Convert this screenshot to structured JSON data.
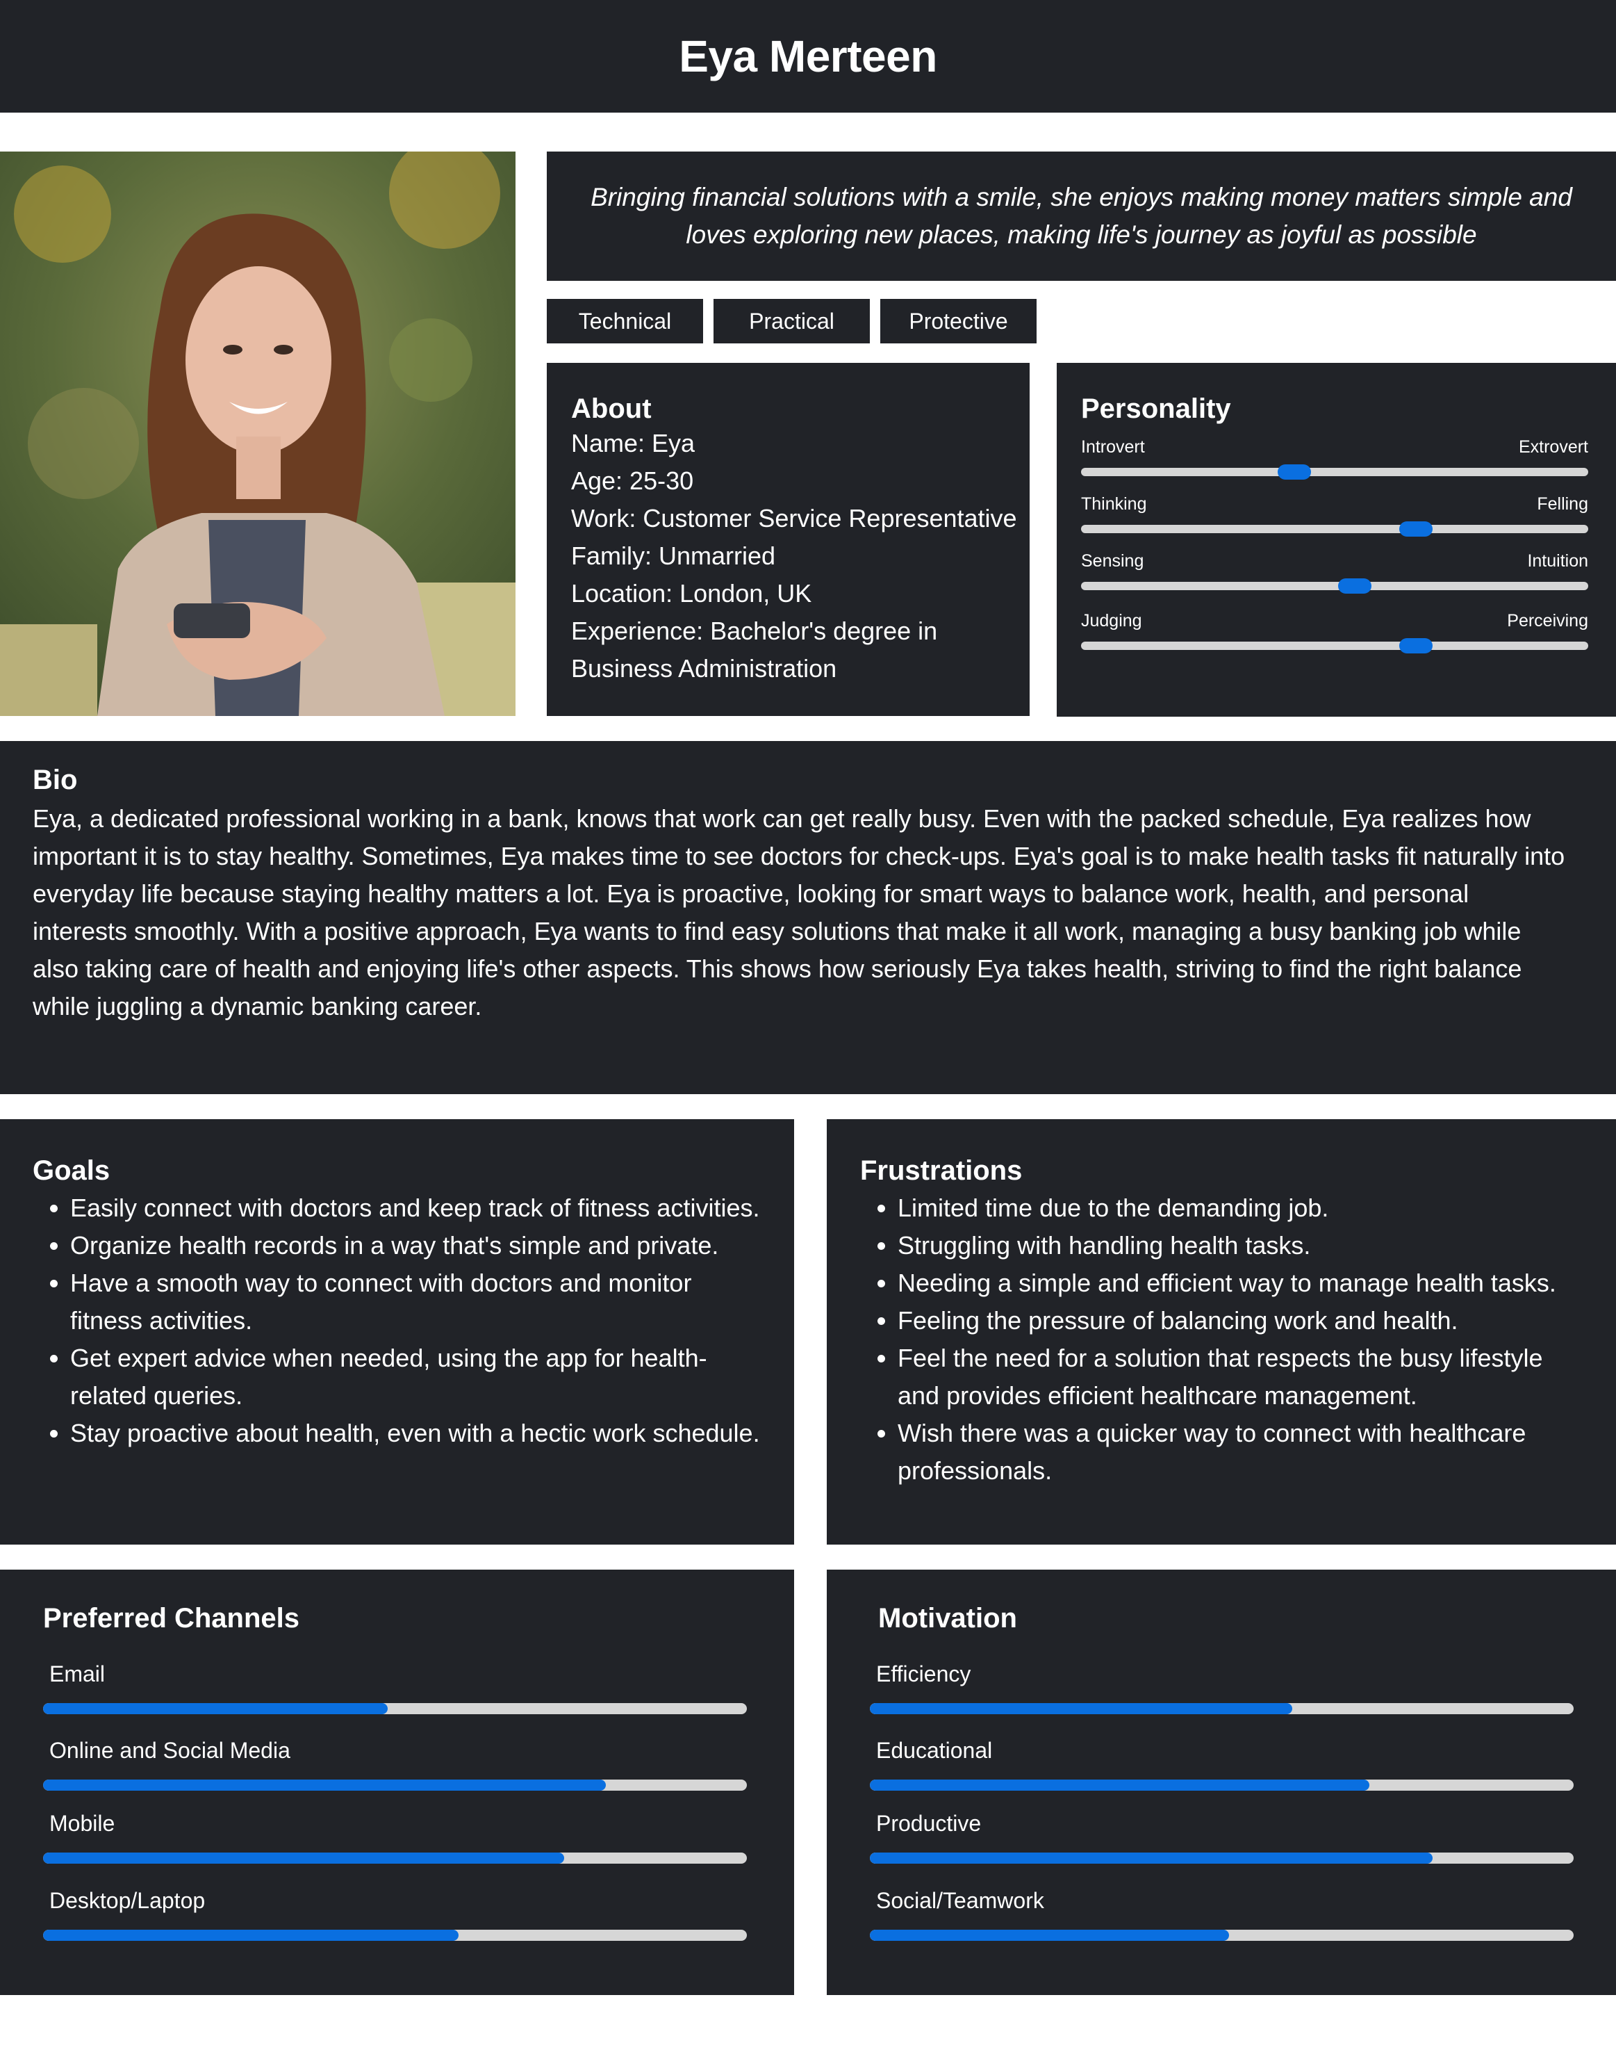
{
  "persona": {
    "name": "Eya Merteen",
    "quote": "Bringing financial solutions with a smile, she enjoys making money matters simple and loves exploring new places, making life's journey as joyful as possible",
    "tags": [
      "Technical",
      "Practical",
      "Protective"
    ]
  },
  "about": {
    "title": "About",
    "rows": [
      "Name: Eya",
      "Age: 25-30",
      "Work: Customer Service Representative",
      "Family: Unmarried",
      "Location: London, UK",
      "Experience: Bachelor's degree in",
      "Business Administration"
    ]
  },
  "personality": {
    "title": "Personality",
    "traits": [
      {
        "left": "Introvert",
        "right": "Extrovert",
        "value": 0.42
      },
      {
        "left": "Thinking",
        "right": "Felling",
        "value": 0.66
      },
      {
        "left": "Sensing",
        "right": "Intuition",
        "value": 0.54
      },
      {
        "left": "Judging",
        "right": "Perceiving",
        "value": 0.66
      }
    ]
  },
  "bio": {
    "title": "Bio",
    "text": "Eya, a dedicated professional working in a bank, knows that work can get really busy. Even with the packed schedule, Eya realizes how important it is to stay healthy. Sometimes, Eya makes time to see doctors for check-ups. Eya's goal is to make health tasks fit naturally into everyday life because staying healthy matters a lot. Eya is proactive, looking for smart ways to balance work, health, and personal interests smoothly. With a positive approach, Eya wants to find easy solutions that make it all work, managing a busy banking job while also taking care of health and enjoying life's other aspects. This shows how seriously Eya takes health, striving to find the right balance while juggling a dynamic banking career."
  },
  "goals": {
    "title": "Goals",
    "items": [
      "Easily connect with doctors and keep track of fitness activities.",
      "Organize health records in a way that's simple and private.",
      "Have a smooth way to connect with doctors and monitor fitness activities.",
      "Get expert advice when needed, using the app for health-related queries.",
      "Stay proactive about health, even with a hectic work schedule."
    ]
  },
  "frustrations": {
    "title": "Frustrations",
    "items": [
      "Limited time due to the demanding job.",
      "Struggling with handling health tasks.",
      "Needing a simple and efficient way to manage health tasks.",
      "Feeling the pressure of balancing work and health.",
      "Feel the need for a solution that respects the busy lifestyle and provides efficient healthcare management.",
      "Wish there was a quicker way to connect with healthcare professionals."
    ]
  },
  "channels": {
    "title": "Preferred Channels",
    "items": [
      {
        "label": "Email",
        "value": 0.49
      },
      {
        "label": "Online and Social Media",
        "value": 0.8
      },
      {
        "label": "Mobile",
        "value": 0.74
      },
      {
        "label": "Desktop/Laptop",
        "value": 0.59
      }
    ]
  },
  "motivation": {
    "title": "Motivation",
    "items": [
      {
        "label": "Efficiency",
        "value": 0.6
      },
      {
        "label": "Educational",
        "value": 0.71
      },
      {
        "label": "Productive",
        "value": 0.8
      },
      {
        "label": "Social/Teamwork",
        "value": 0.51
      }
    ]
  },
  "colors": {
    "panel": "#212328",
    "accent": "#0a6fe0",
    "track": "#d6d6d6"
  }
}
